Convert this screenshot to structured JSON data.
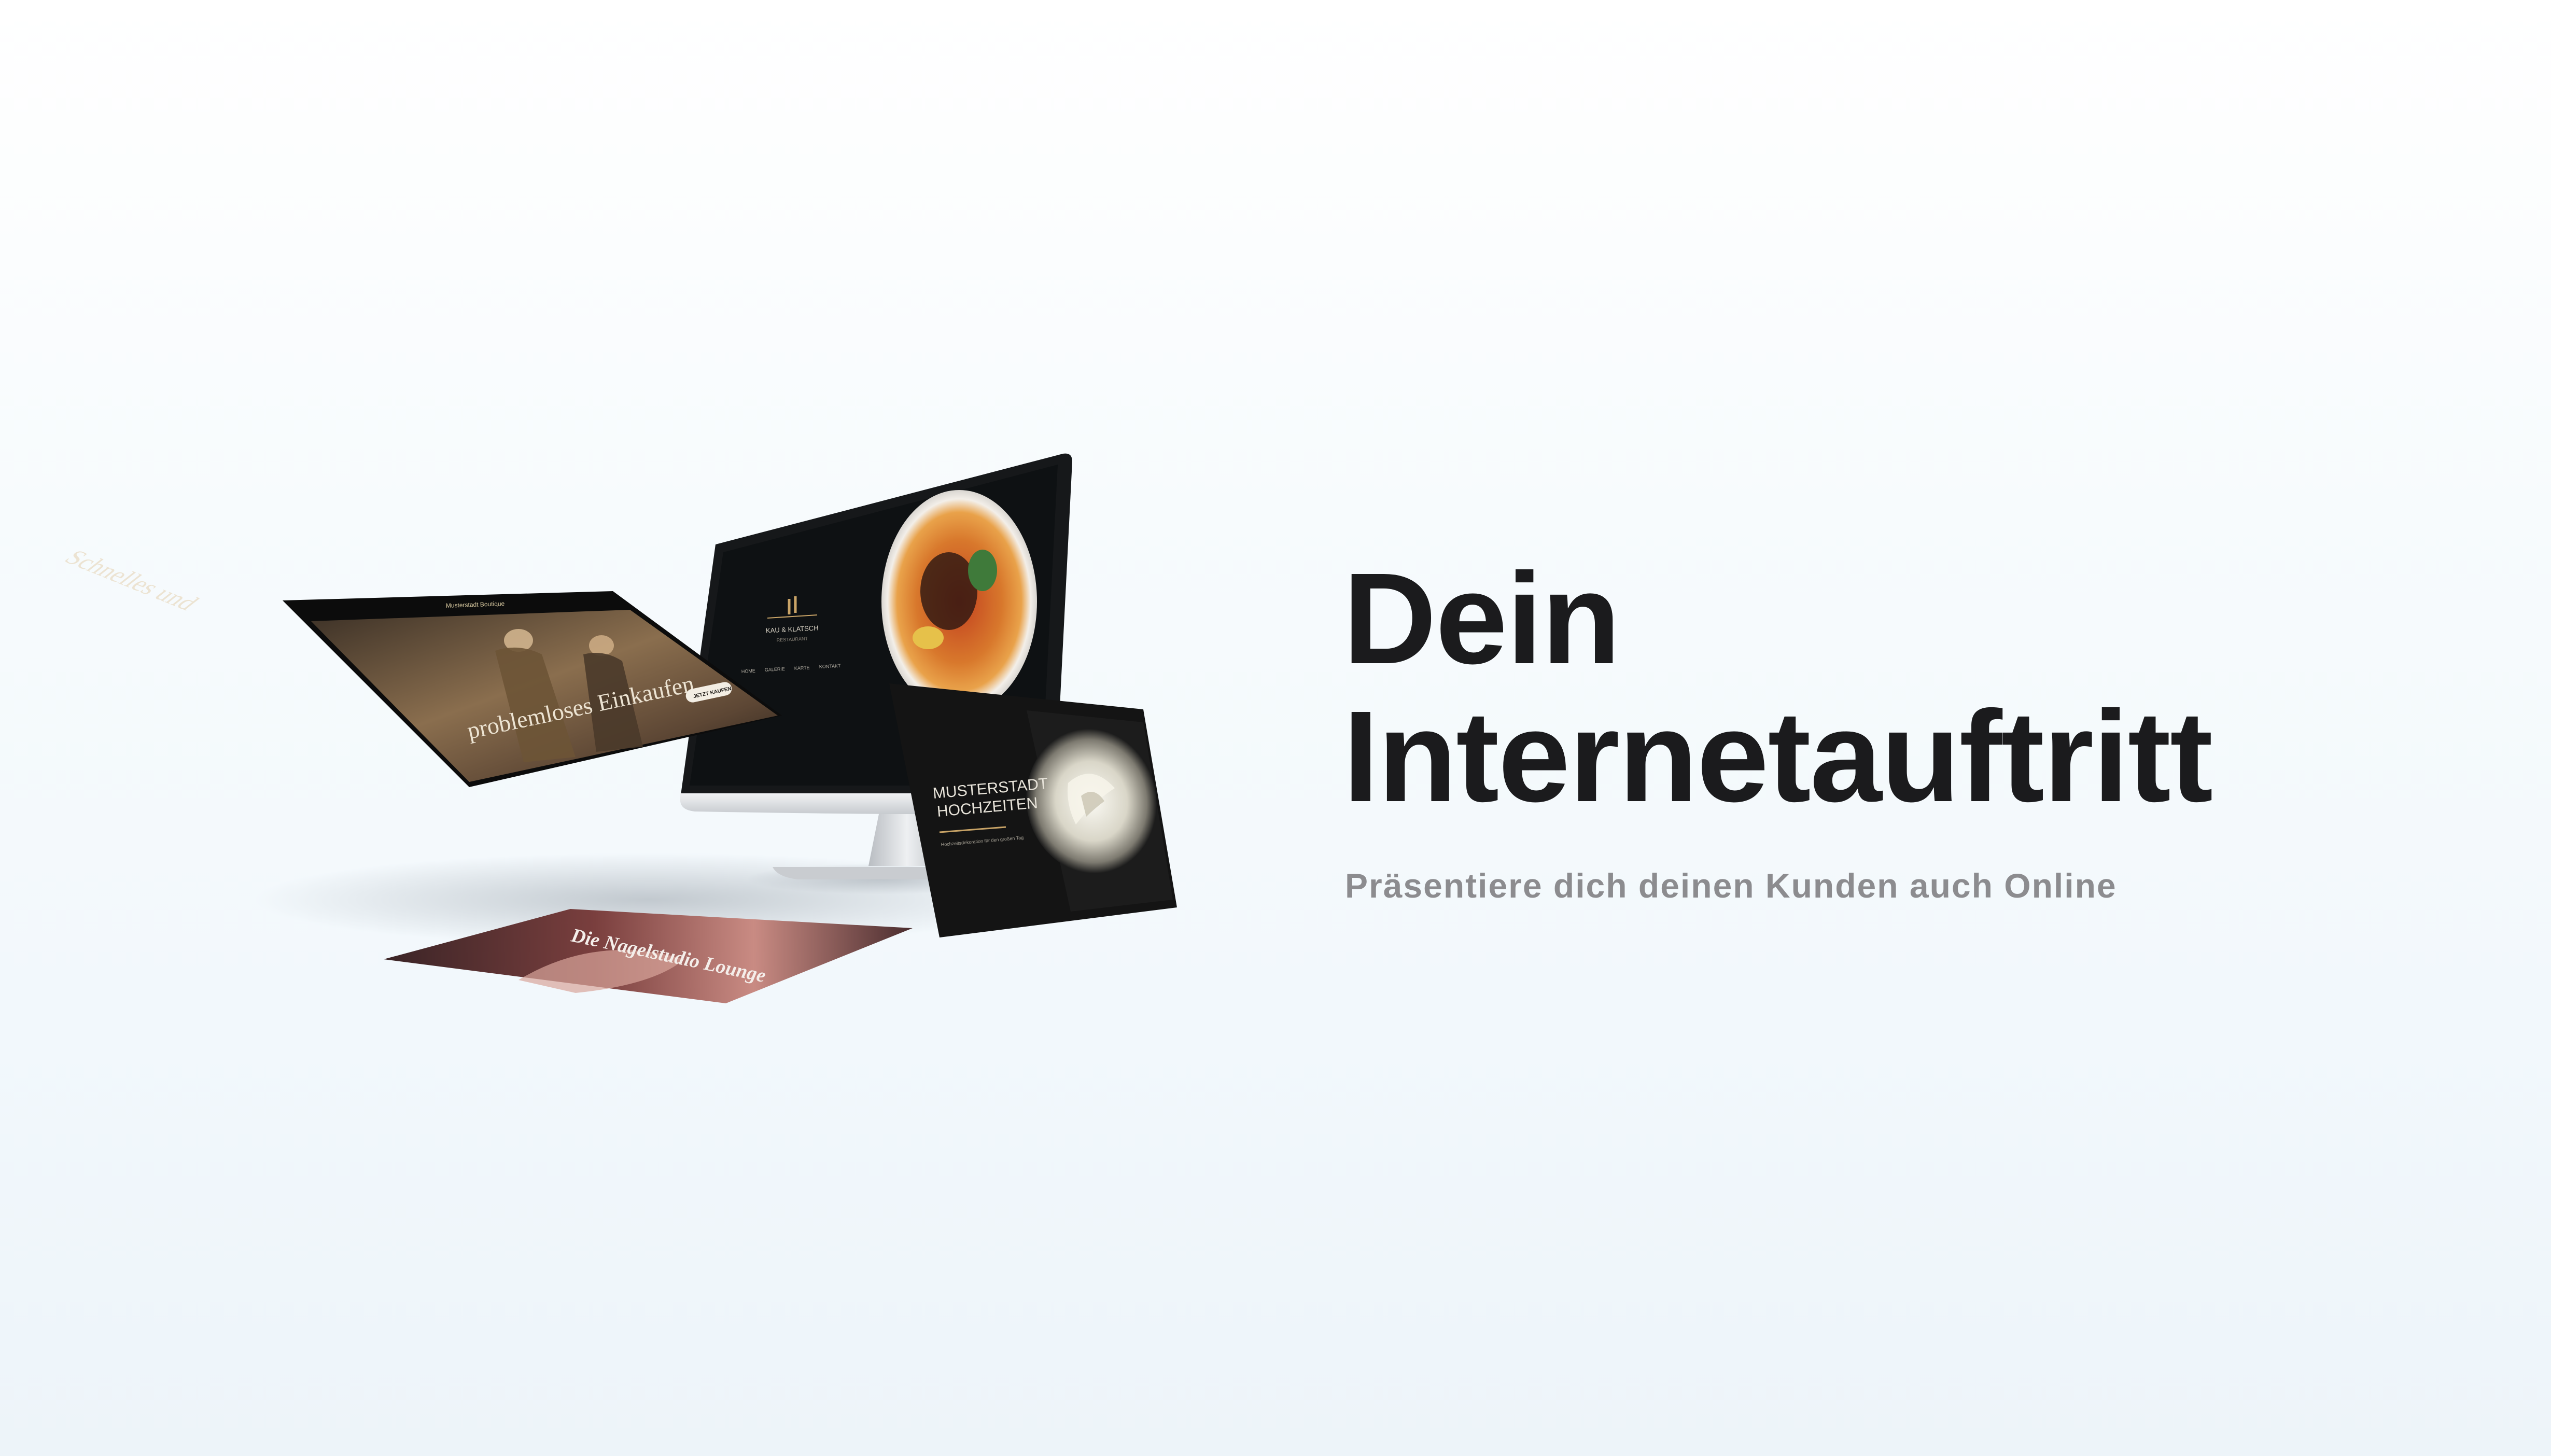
{
  "hero": {
    "title_line1": "Dein",
    "title_line2": "Internetauftritt",
    "subtitle": "Präsentiere dich deinen Kunden auch Online"
  },
  "mockups": {
    "monitor": {
      "brand_text": "KAU & KLATSCH",
      "brand_sub": "RESTAURANT",
      "nav": [
        "HOME",
        "GALERIE",
        "KARTE",
        "KONTAKT"
      ]
    },
    "floating_screen_left": {
      "top_bar_text": "Musterstadt Boutique",
      "headline_1": "Schnelles und",
      "headline_2": "problemloses Einkaufen",
      "cta_label": "JETZT KAUFEN"
    },
    "wedding_card": {
      "title_1": "MUSTERSTADT",
      "title_2": "HOCHZEITEN",
      "tagline": "Hochzeitsdekoration für den großen Tag"
    },
    "bottom_screen": {
      "headline": "Die Nagelstudio Lounge"
    }
  },
  "colors": {
    "title": "#1b1b1d",
    "subtitle": "#8c8c8f",
    "screen_dark": "#101214",
    "accent_gold": "#c9a467",
    "monitor_silver": "#d9dcdf"
  }
}
